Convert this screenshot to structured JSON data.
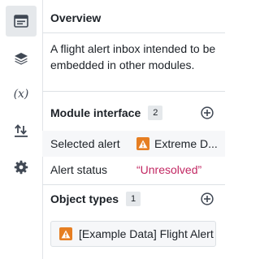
{
  "rail": {
    "items": [
      {
        "icon": "panel-overview-icon",
        "active": true
      },
      {
        "icon": "layers-icon",
        "active": false
      },
      {
        "icon": "variable-icon",
        "glyph": "(x)",
        "active": false
      },
      {
        "icon": "transfer-icon",
        "active": false
      },
      {
        "icon": "gear-icon",
        "active": false
      }
    ]
  },
  "overview": {
    "title": "Overview",
    "description": "A flight alert inbox intended to be embedded in other modules."
  },
  "module_interface": {
    "title": "Module interface",
    "count": "2",
    "rows": [
      {
        "label": "Selected alert",
        "value": "Extreme D...",
        "icon": "warning-icon"
      },
      {
        "label": "Alert status",
        "value": "“Unresolved”"
      }
    ]
  },
  "object_types": {
    "title": "Object types",
    "count": "1",
    "items": [
      {
        "label": "[Example Data] Flight Alert",
        "icon": "warning-icon"
      }
    ]
  },
  "colors": {
    "warning": "#e67e22",
    "status_string": "#c22762",
    "rail_active": "#e5e8eb"
  }
}
